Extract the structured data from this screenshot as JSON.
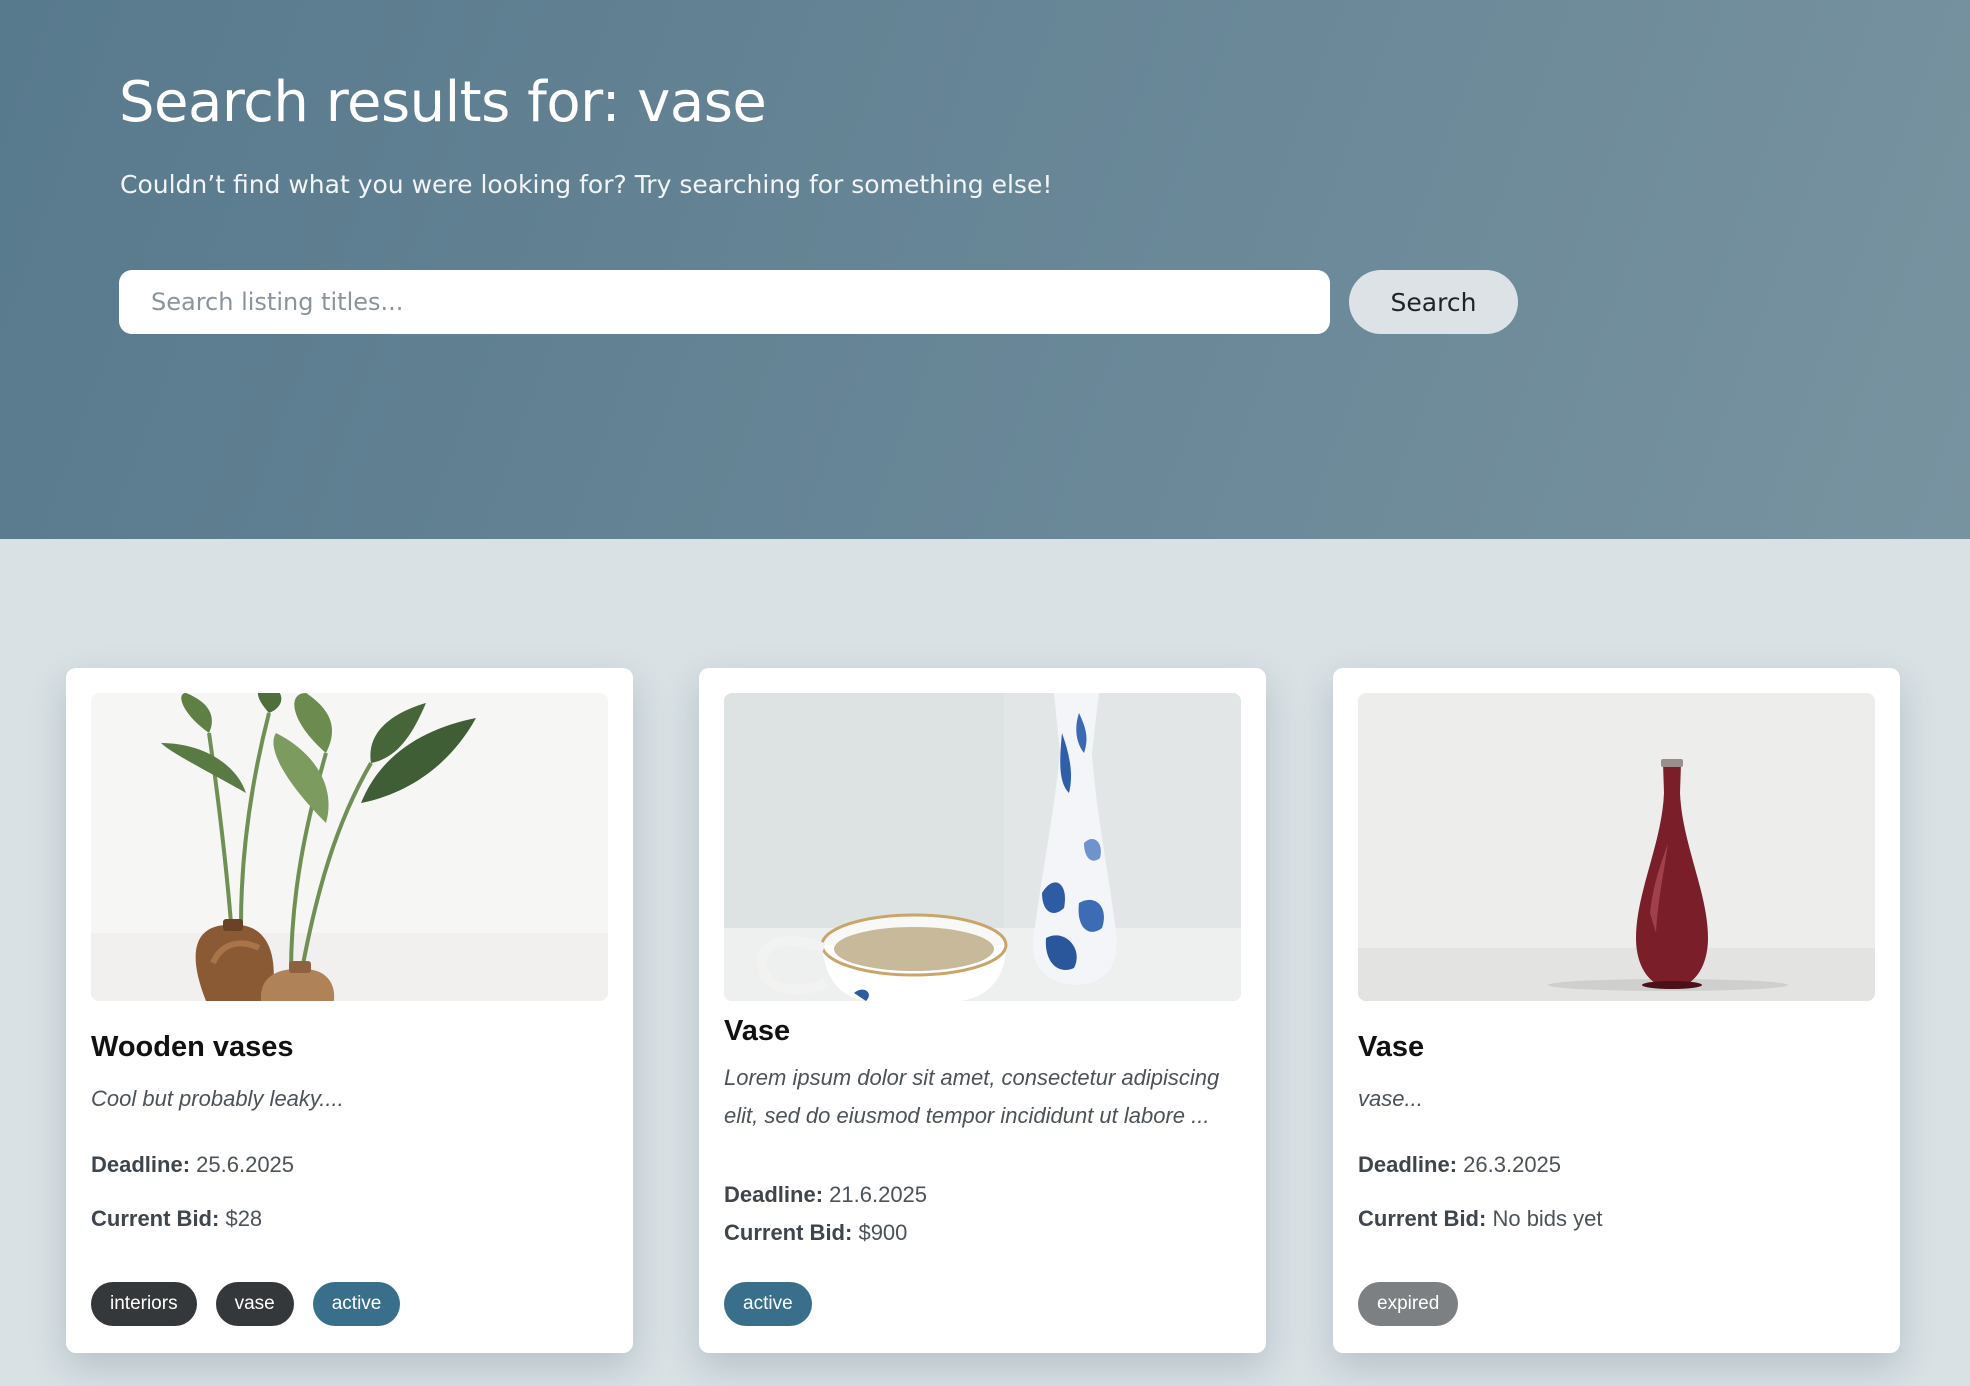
{
  "hero": {
    "title": "Search results for: vase",
    "subtitle": "Couldn’t find what you were looking for? Try searching for something else!",
    "search_placeholder": "Search listing titles...",
    "search_button": "Search"
  },
  "labels": {
    "deadline": "Deadline:",
    "current_bid": "Current Bid:"
  },
  "listings": [
    {
      "title": "Wooden vases",
      "description": "Cool but probably leaky....",
      "deadline": "25.6.2025",
      "current_bid": "$28",
      "tags": [
        "interiors",
        "vase"
      ],
      "status": "active",
      "image": "plant-wooden-vases"
    },
    {
      "title": "Vase",
      "description": "Lorem ipsum dolor sit amet, consectetur adipiscing elit, sed do eiusmod tempor incididunt ut labore ...",
      "deadline": "21.6.2025",
      "current_bid": "$900",
      "tags": [],
      "status": "active",
      "image": "porcelain-vase-teacup"
    },
    {
      "title": "Vase",
      "description": "vase...",
      "deadline": "26.3.2025",
      "current_bid": "No bids yet",
      "tags": [],
      "status": "expired",
      "image": "red-bud-vase"
    }
  ],
  "colors": {
    "hero_bg": "#5f8092",
    "page_bg": "#d9e1e5",
    "tag_dark": "#35383b",
    "status_active": "#3a6f8c",
    "status_expired": "#7c8083"
  }
}
